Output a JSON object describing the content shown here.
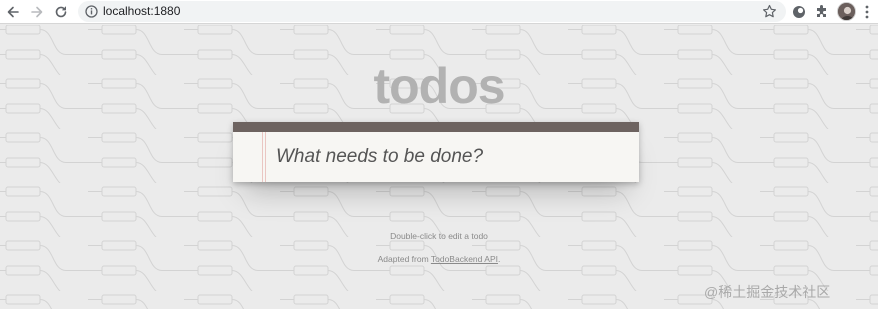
{
  "browser": {
    "url": "localhost:1880",
    "icons": {
      "back": "arrow-left-icon",
      "forward": "arrow-right-icon",
      "reload": "reload-icon",
      "info": "info-circle-icon",
      "bookmark": "star-icon",
      "extension_1": "circle-extension-icon",
      "extension_2": "puzzle-icon",
      "profile": "avatar",
      "menu": "kebab-menu-icon"
    }
  },
  "app": {
    "title": "todos",
    "new_todo_placeholder": "What needs to be done?",
    "new_todo_value": "",
    "footer": {
      "hint": "Double-click to edit a todo",
      "credit_prefix": "Adapted from ",
      "credit_link": "TodoBackend API",
      "credit_suffix": "."
    }
  },
  "watermark": "@稀土掘金技术社区",
  "colors": {
    "page_bg": "#ebebeb",
    "pattern": "#d3d3d3",
    "title": "#b2b2b2",
    "card_bar": "#6d6360",
    "card_bg": "#f7f6f3"
  }
}
